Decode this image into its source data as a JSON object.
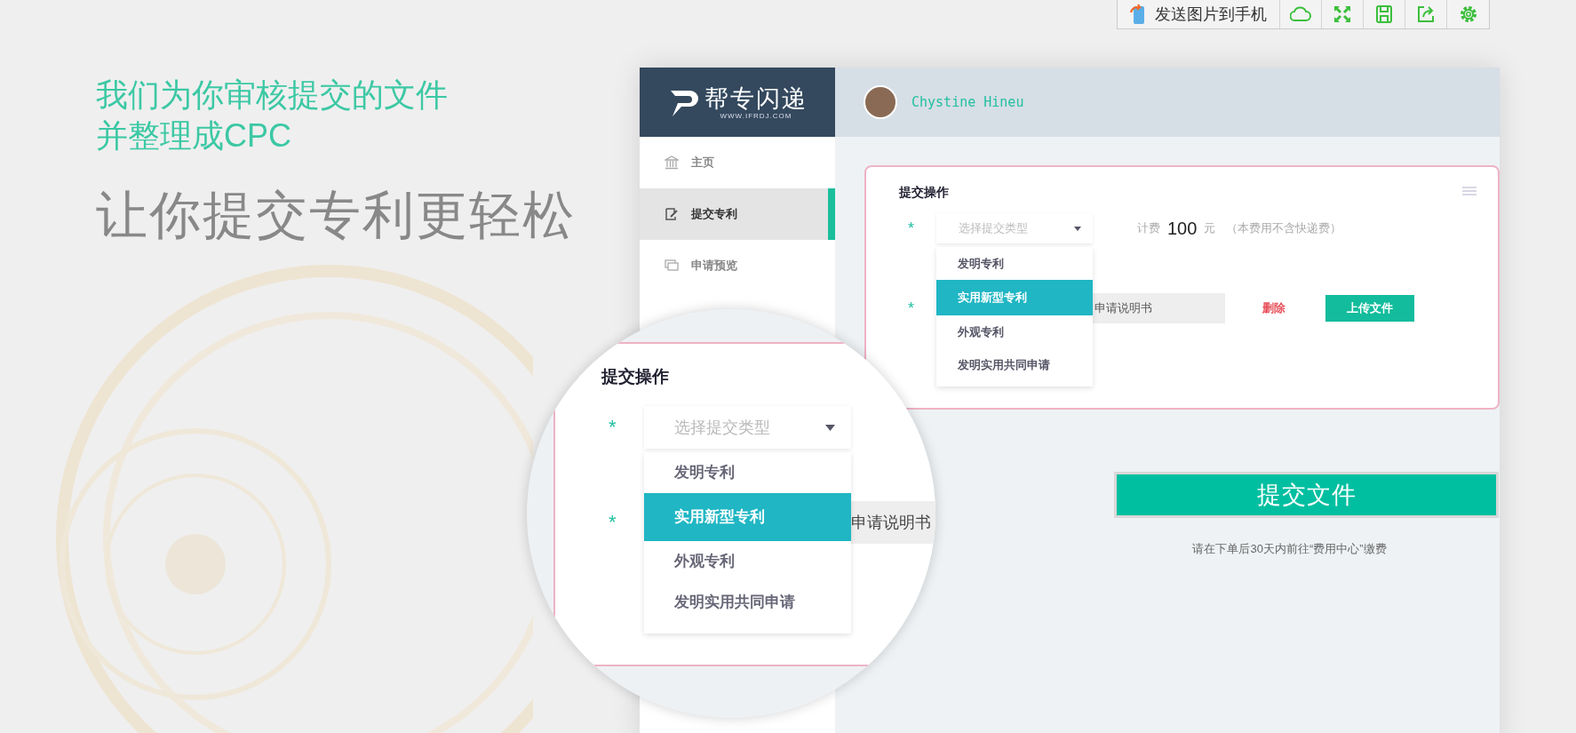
{
  "toolbar": {
    "send_button": "发送图片到手机"
  },
  "hero": {
    "headline": [
      "我们为你审核提交的文件",
      "并整理成CPC"
    ],
    "tagline": "让你提交专利更轻松"
  },
  "mockup": {
    "logo": {
      "name": "帮专闪递",
      "url": "WWW.IFRDJ.COM"
    },
    "user": {
      "name": "Chystine Hineu"
    },
    "sidebar": {
      "items": [
        {
          "label": "主页",
          "selected": false,
          "kind": "home"
        },
        {
          "label": "提交专利",
          "selected": true,
          "kind": "edit"
        },
        {
          "label": "申请预览",
          "selected": false,
          "kind": "preview"
        }
      ]
    },
    "card": {
      "title": "提交操作",
      "required_mark": "*",
      "type_select": {
        "placeholder": "选择提交类型",
        "expanded": true,
        "options": [
          {
            "label": "发明专利",
            "selected": false
          },
          {
            "label": "实用新型专利",
            "selected": true
          },
          {
            "label": "外观专利",
            "selected": false
          },
          {
            "label": "发明实用共同申请",
            "selected": false
          }
        ]
      },
      "fee": {
        "label": "计费",
        "amount": "100",
        "unit": "元",
        "note": "（本费用不含快递费）"
      },
      "document": {
        "value": "申请说明书",
        "delete": "删除",
        "upload": "上传文件"
      }
    },
    "submit_button": "提交文件",
    "note": "请在下单后30天内前往“费用中心”缴费"
  },
  "magnifier": {
    "title": "提交操作",
    "required_mark": "*",
    "placeholder": "选择提交类型",
    "options": [
      {
        "label": "发明专利",
        "selected": false
      },
      {
        "label": "实用新型专利",
        "selected": true
      },
      {
        "label": "外观专利",
        "selected": false
      },
      {
        "label": "发明实用共同申请",
        "selected": false
      }
    ],
    "document_value": "申请说明书"
  }
}
